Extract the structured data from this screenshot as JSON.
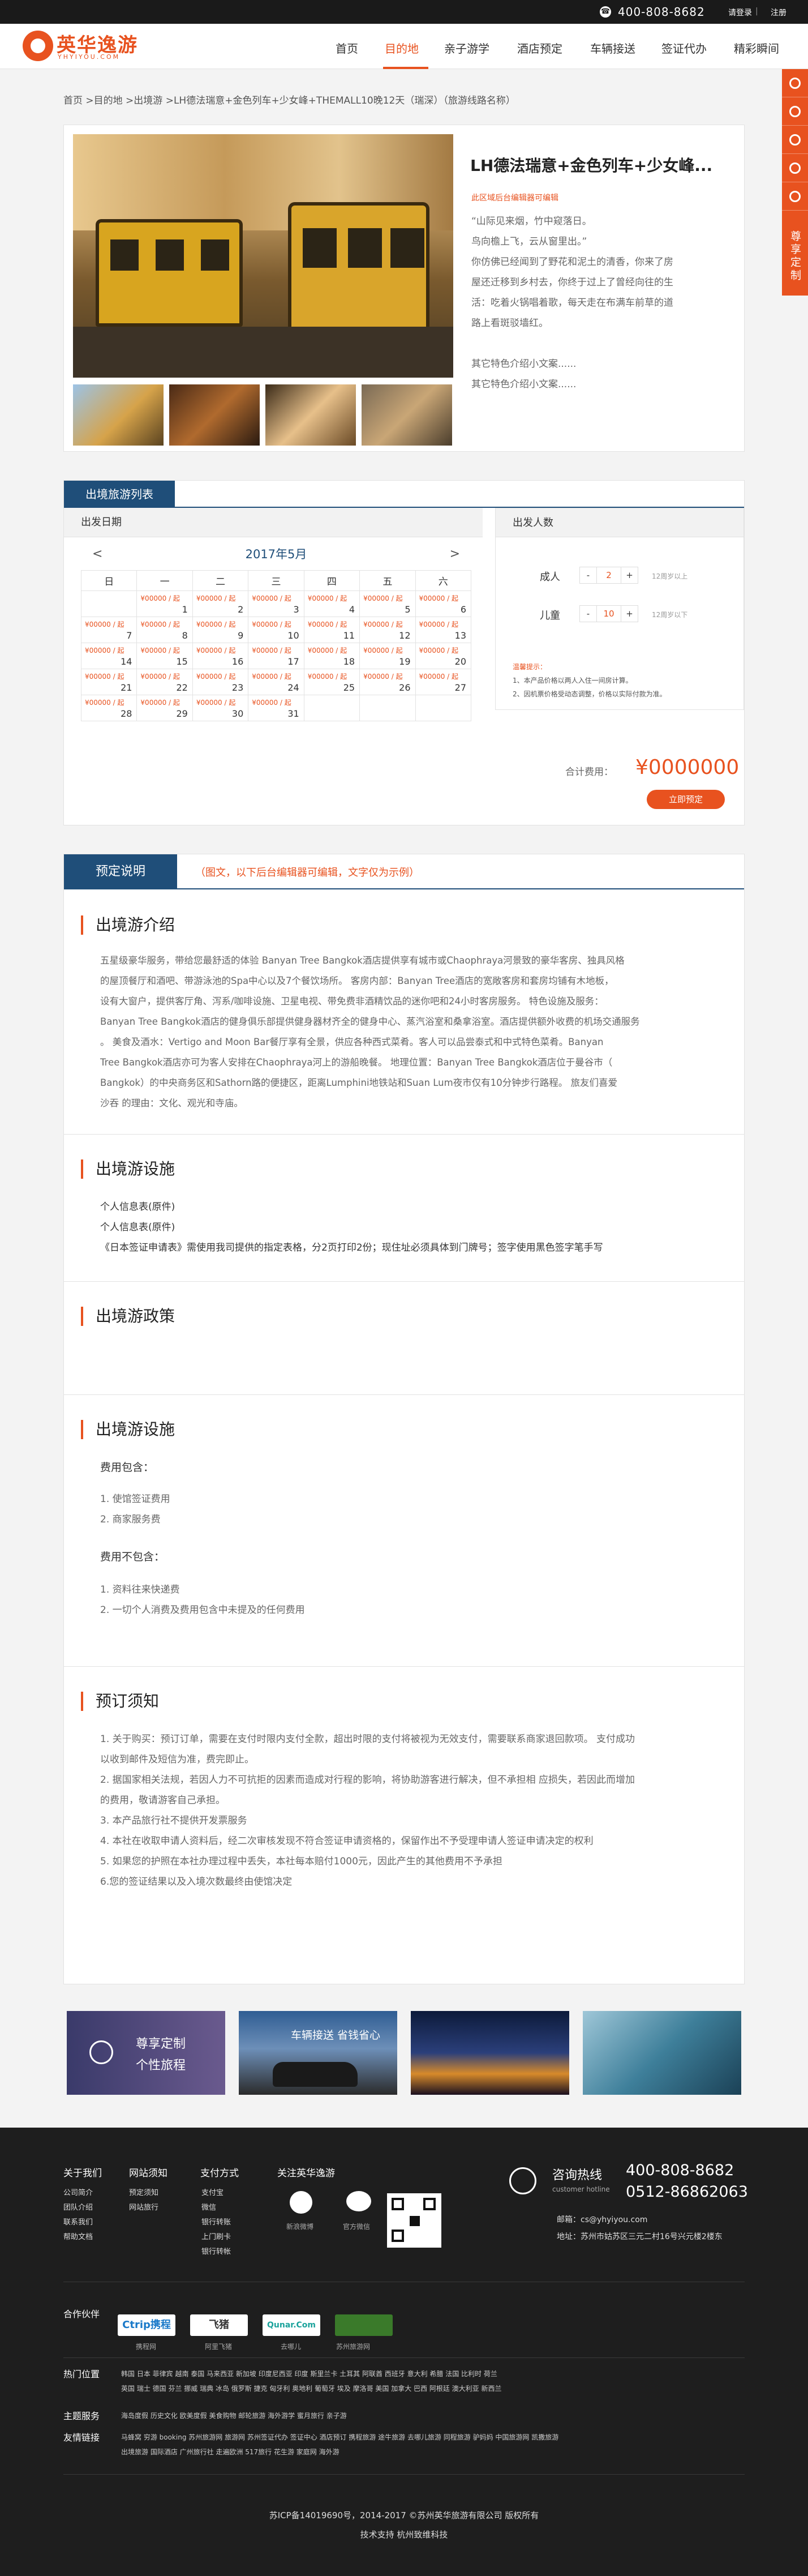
{
  "topbar": {
    "phone": "400-808-8682",
    "login": "请登录",
    "sep": "|",
    "register": "注册"
  },
  "header": {
    "logo_text": "英华逸游",
    "logo_sub": "YHYIYOU.COM",
    "nav": [
      "首页",
      "目的地",
      "亲子游学",
      "酒店预定",
      "车辆接送",
      "签证代办",
      "精彩瞬间"
    ]
  },
  "float": {
    "custom_label": "尊享定制"
  },
  "breadcrumb": "首页  >目的地 >出境游 >LH德法瑞意+金色列车+少女峰+THEMALL10晚12天（瑞深）（旅游线路名称）",
  "product": {
    "title": "LH德法瑞意+金色列车+少女峰...",
    "tag": "此区域后台编辑器可编辑",
    "desc": [
      "“山际见来烟，竹中窥落日。",
      "鸟向檐上飞，云从窗里出。”",
      "你仿佛已经闻到了野花和泥土的清香，你来了房",
      "屋还迁移到乡村去，你终于过上了曾经向往的生",
      "活：吃着火锅唱着歌，每天走在布满车前草的道",
      "路上看斑驳墙红。",
      "",
      "其它特色介绍小文案......",
      "其它特色介绍小文案......"
    ]
  },
  "list": {
    "tab": "出境旅游列表",
    "date_header": "出发日期",
    "people_header": "出发人数",
    "month": "2017年5月",
    "prev": "<",
    "next": ">",
    "weekdays": [
      "日",
      "一",
      "二",
      "三",
      "四",
      "五",
      "六"
    ],
    "price_label": "¥00000 / 起",
    "weeks": [
      [
        "",
        "1",
        "2",
        "3",
        "4",
        "5",
        "6"
      ],
      [
        "7",
        "8",
        "9",
        "10",
        "11",
        "12",
        "13"
      ],
      [
        "14",
        "15",
        "16",
        "17",
        "18",
        "19",
        "20"
      ],
      [
        "21",
        "22",
        "23",
        "24",
        "25",
        "26",
        "27"
      ],
      [
        "28",
        "29",
        "30",
        "31",
        "",
        "",
        ""
      ]
    ],
    "adult_label": "成人",
    "adult_value": "2",
    "adult_note": "12周岁以上",
    "child_label": "儿童",
    "child_value": "10",
    "child_note": "12周岁以下",
    "minus": "-",
    "plus": "+",
    "warn_title": "温馨提示：",
    "warn_1": "1、本产品价格以两人入住一间房计算。",
    "warn_2": "2、因机票价格受动态调整，价格以实际付款为准。",
    "total_label": "合计费用：",
    "total_value": "¥0000000",
    "book_button": "立即预定"
  },
  "detail": {
    "tab": "预定说明",
    "note": "（图文，以下后台编辑器可编辑，文字仅为示例）",
    "intro_title": "出境游介绍",
    "intro_text": [
      "五星级豪华服务，带给您最舒适的体验 Banyan Tree Bangkok酒店提供享有城市或Chaophraya河景致的豪华客房、独具风格",
      "的屋顶餐厅和酒吧、带游泳池的Spa中心以及7个餐饮场所。 客房内部：Banyan Tree酒店的宽敞客房和套房均铺有木地板，",
      "设有大窗户，提供客厅角、泻系/咖啡设施、卫星电视、带免费非酒精饮品的迷你吧和24小时客房服务。        特色设施及服务：",
      "Banyan Tree Bangkok酒店的健身俱乐部提供健身器材齐全的健身中心、蒸汽浴室和桑拿浴室。酒店提供额外收费的机场交通服务",
      "。 美食及酒水：Vertigo and Moon Bar餐厅享有全景，供应各种西式菜肴。客人可以品尝泰式和中式特色菜肴。Banyan",
      "Tree Bangkok酒店亦可为客人安排在Chaophraya河上的游船晚餐。   地理位置：Banyan Tree Bangkok酒店位于曼谷市（",
      "Bangkok）的中央商务区和Sathorn路的便捷区，距离Lumphini地铁站和Suan Lum夜市仅有10分钟步行路程。    旅友们喜爱",
      "沙吞 的理由：文化、观光和寺庙。"
    ],
    "facility_title": "出境游设施",
    "facility_text": [
      "个人信息表(原件)",
      "个人信息表(原件)",
      "《日本签证申请表》需使用我司提供的指定表格，分2页打印2份；现住址必须具体到门牌号；签字使用黑色签字笔手写"
    ],
    "policy_title": "出境游政策",
    "facility2_title": "出境游设施",
    "include_label": "费用包含：",
    "include": [
      "1. 使馆签证费用",
      "2. 商家服务费"
    ],
    "exclude_label": "费用不包含：",
    "exclude": [
      "1. 资料往来快递费",
      "2. 一切个人消费及费用包含中未提及的任何费用"
    ],
    "notice_title": "预订须知",
    "notice": [
      "1. 关于购买：预订订单，需要在支付时限内支付全款，超出时限的支付将被视为无效支付，需要联系商家退回款项。 支付成功",
      "以收到邮件及短信为准，费完即止。",
      "2. 据国家相关法规，若因人力不可抗拒的因素而造成对行程的影响，将协助游客进行解决，但不承担相 应损失，若因此而增加",
      "的费用，敬请游客自己承担。",
      "3. 本产品旅行社不提供开发票服务",
      "4. 本社在收取申请人资料后，经二次审核发现不符合签证申请资格的，保留作出不予受理申请人签证申请决定的权利",
      "5. 如果您的护照在本社办理过程中丢失，本社每本赔付1000元，因此产生的其他费用不予承担",
      "6.您的签证结果以及入境次数最终由使馆决定"
    ]
  },
  "promos": [
    {
      "line1": "尊享定制",
      "line2": "个性旅程"
    },
    {
      "line1": "车辆接送  省钱省心",
      "line2": ""
    },
    {
      "line1": "",
      "line2": ""
    },
    {
      "line1": "",
      "line2": ""
    }
  ],
  "footer": {
    "cols": [
      {
        "title": "关于我们",
        "links": [
          "公司简介",
          "团队介绍",
          "联系我们",
          "帮助文档"
        ]
      },
      {
        "title": "网站须知",
        "links": [
          "预定须知",
          "网站旅行"
        ]
      },
      {
        "title": "支付方式",
        "links": [
          "支付宝",
          "微信",
          "银行转账",
          "上门刷卡",
          "银行转帐"
        ]
      }
    ],
    "follow_title": "关注英华逸游",
    "weibo": "新浪微博",
    "wechat": "官方微信",
    "hotline_title": "咨询热线",
    "hotline_en": "customer hotline",
    "hotline_1": "400-808-8682",
    "hotline_2": "0512-86862063",
    "email": "邮箱：cs@yhyiyou.com",
    "address": "地址：苏州市姑苏区三元二村16号兴元楼2楼东",
    "partners_title": "合作伙伴",
    "partners": [
      {
        "logo": "Ctrip携程",
        "name": "携程网"
      },
      {
        "logo": "飞猪",
        "name": "阿里飞猪"
      },
      {
        "logo": "Qunar.Com",
        "name": "去哪儿"
      },
      {
        "logo": "",
        "name": "苏州旅游网"
      }
    ],
    "hot_title": "热门位置",
    "hot_1": "韩国   日本   菲律宾   越南   泰国   马来西亚   新加坡   印度尼西亚   印度   斯里兰卡   土耳其   阿联酋   西班牙   意大利   希腊   法国   比利时   荷兰",
    "hot_2": "英国   瑞士   德国   芬兰   挪威   瑞典   冰岛   俄罗斯   捷克   匈牙利   奥地利   葡萄牙   埃及   摩洛哥   美国   加拿大   巴西   阿根廷   澳大利亚   新西兰",
    "theme_title": "主题服务",
    "theme": "海岛度假   历史文化   欧美度假   美食购物   邮轮旅游   海外游学   蜜月旅行   亲子游",
    "links_title": "友情链接",
    "links_1": "马蜂窝   穷游   booking   苏州旅游网   旅游网   苏州签证代办   签证中心   酒店预订   携程旅游   途牛旅游   去哪儿旅游   同程旅游   驴妈妈   中国旅游网   凯撒旅游",
    "links_2": "出境旅游   国际酒店   广州旅行社   走遍欧洲   517旅行   花生游   家庭网   海外游",
    "copyright": "苏ICP备14019690号，2014-2017 ©苏州英华旅游有限公司 版权所有",
    "support": "技术支持  杭州致维科技"
  }
}
